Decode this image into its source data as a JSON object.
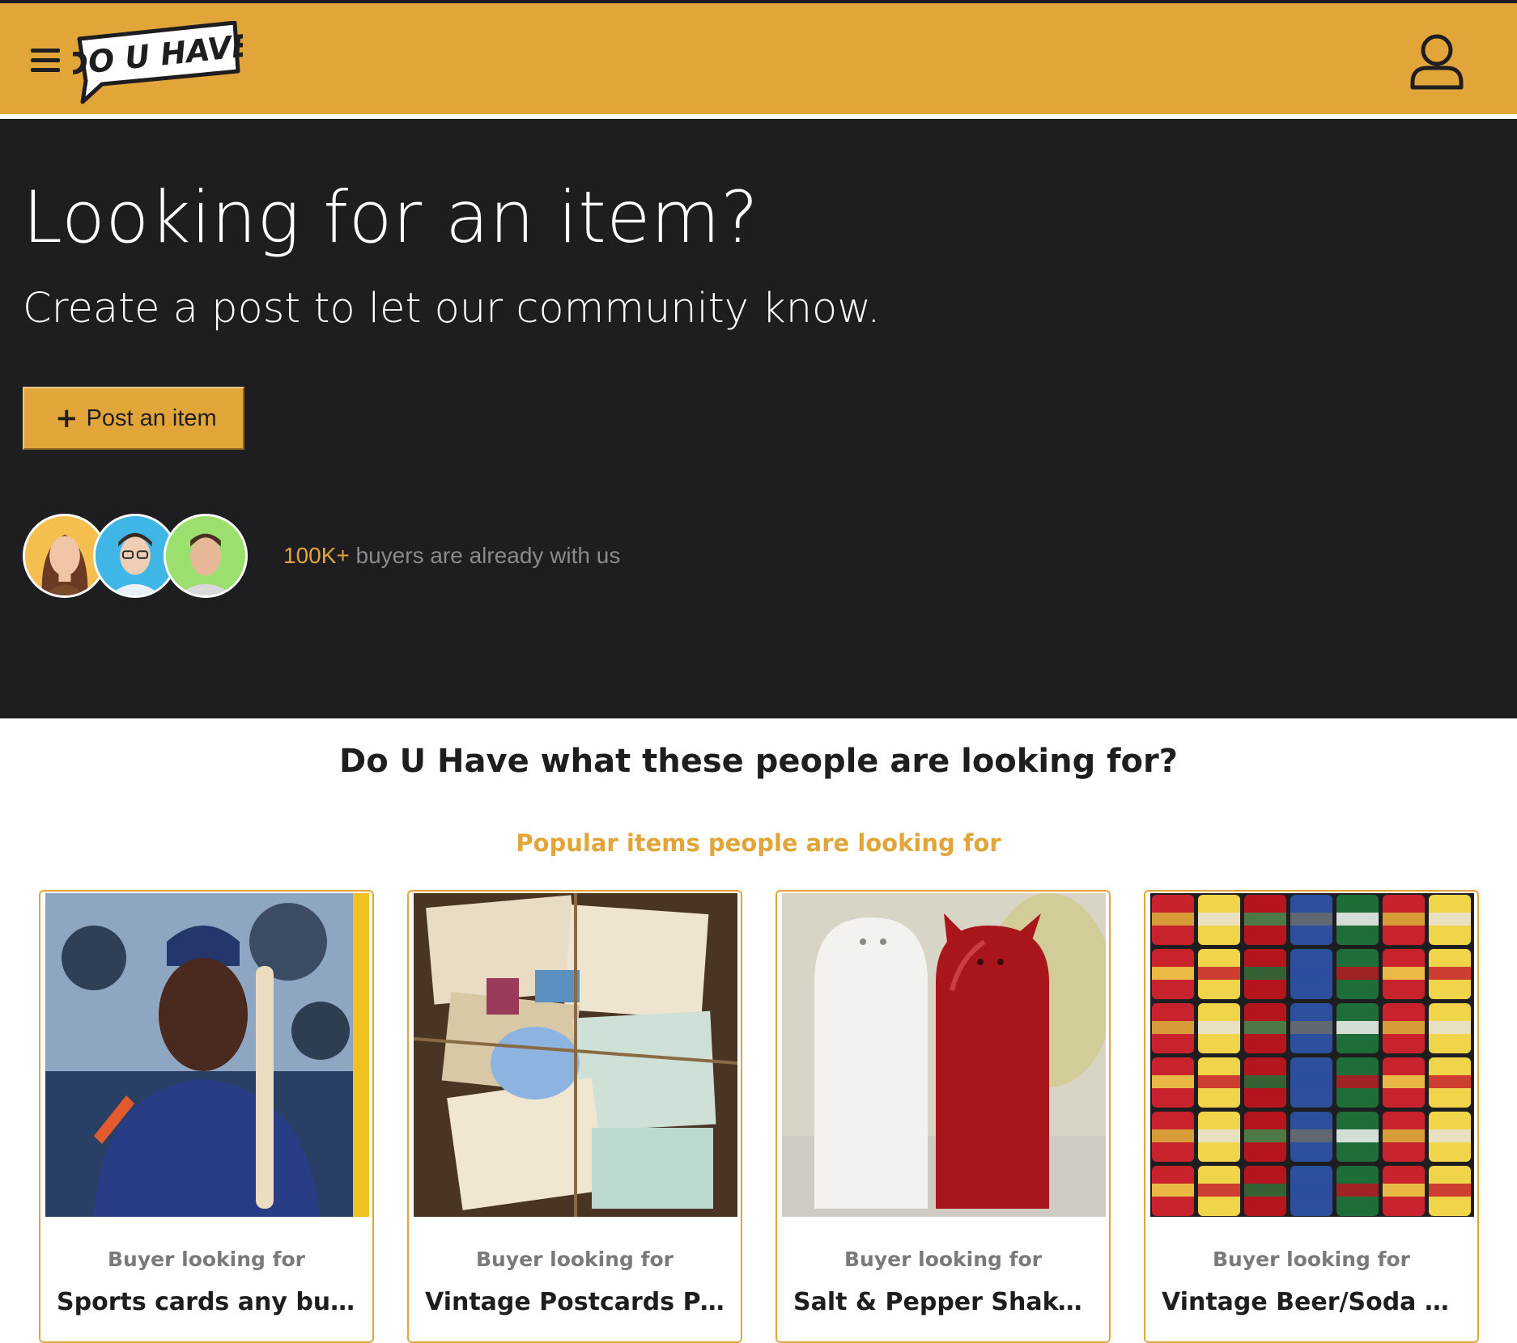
{
  "header": {
    "logo_text": "DO U HAVE",
    "menu_icon": "hamburger-menu-icon",
    "user_icon": "user-account-icon"
  },
  "hero": {
    "title": "Looking for an item?",
    "subtitle": "Create a post to let our community know.",
    "post_button_label": "Post an item",
    "post_button_icon": "plus-icon",
    "buyers_count": "100K+",
    "buyers_text": " buyers are already with us"
  },
  "section": {
    "title": "Do U Have what these people are looking for?",
    "subtitle": "Popular items people are looking for"
  },
  "cards": [
    {
      "kicker": "Buyer looking for",
      "title": "Sports cards any buy o..."
    },
    {
      "kicker": "Buyer looking for",
      "title": "Vintage Postcards Pap..."
    },
    {
      "kicker": "Buyer looking for",
      "title": "Salt & Pepper Shakers"
    },
    {
      "kicker": "Buyer looking for",
      "title": "Vintage Beer/Soda Ca..."
    }
  ],
  "colors": {
    "brand": "#e2a53a",
    "dark": "#1e1e21",
    "white": "#ffffff"
  }
}
